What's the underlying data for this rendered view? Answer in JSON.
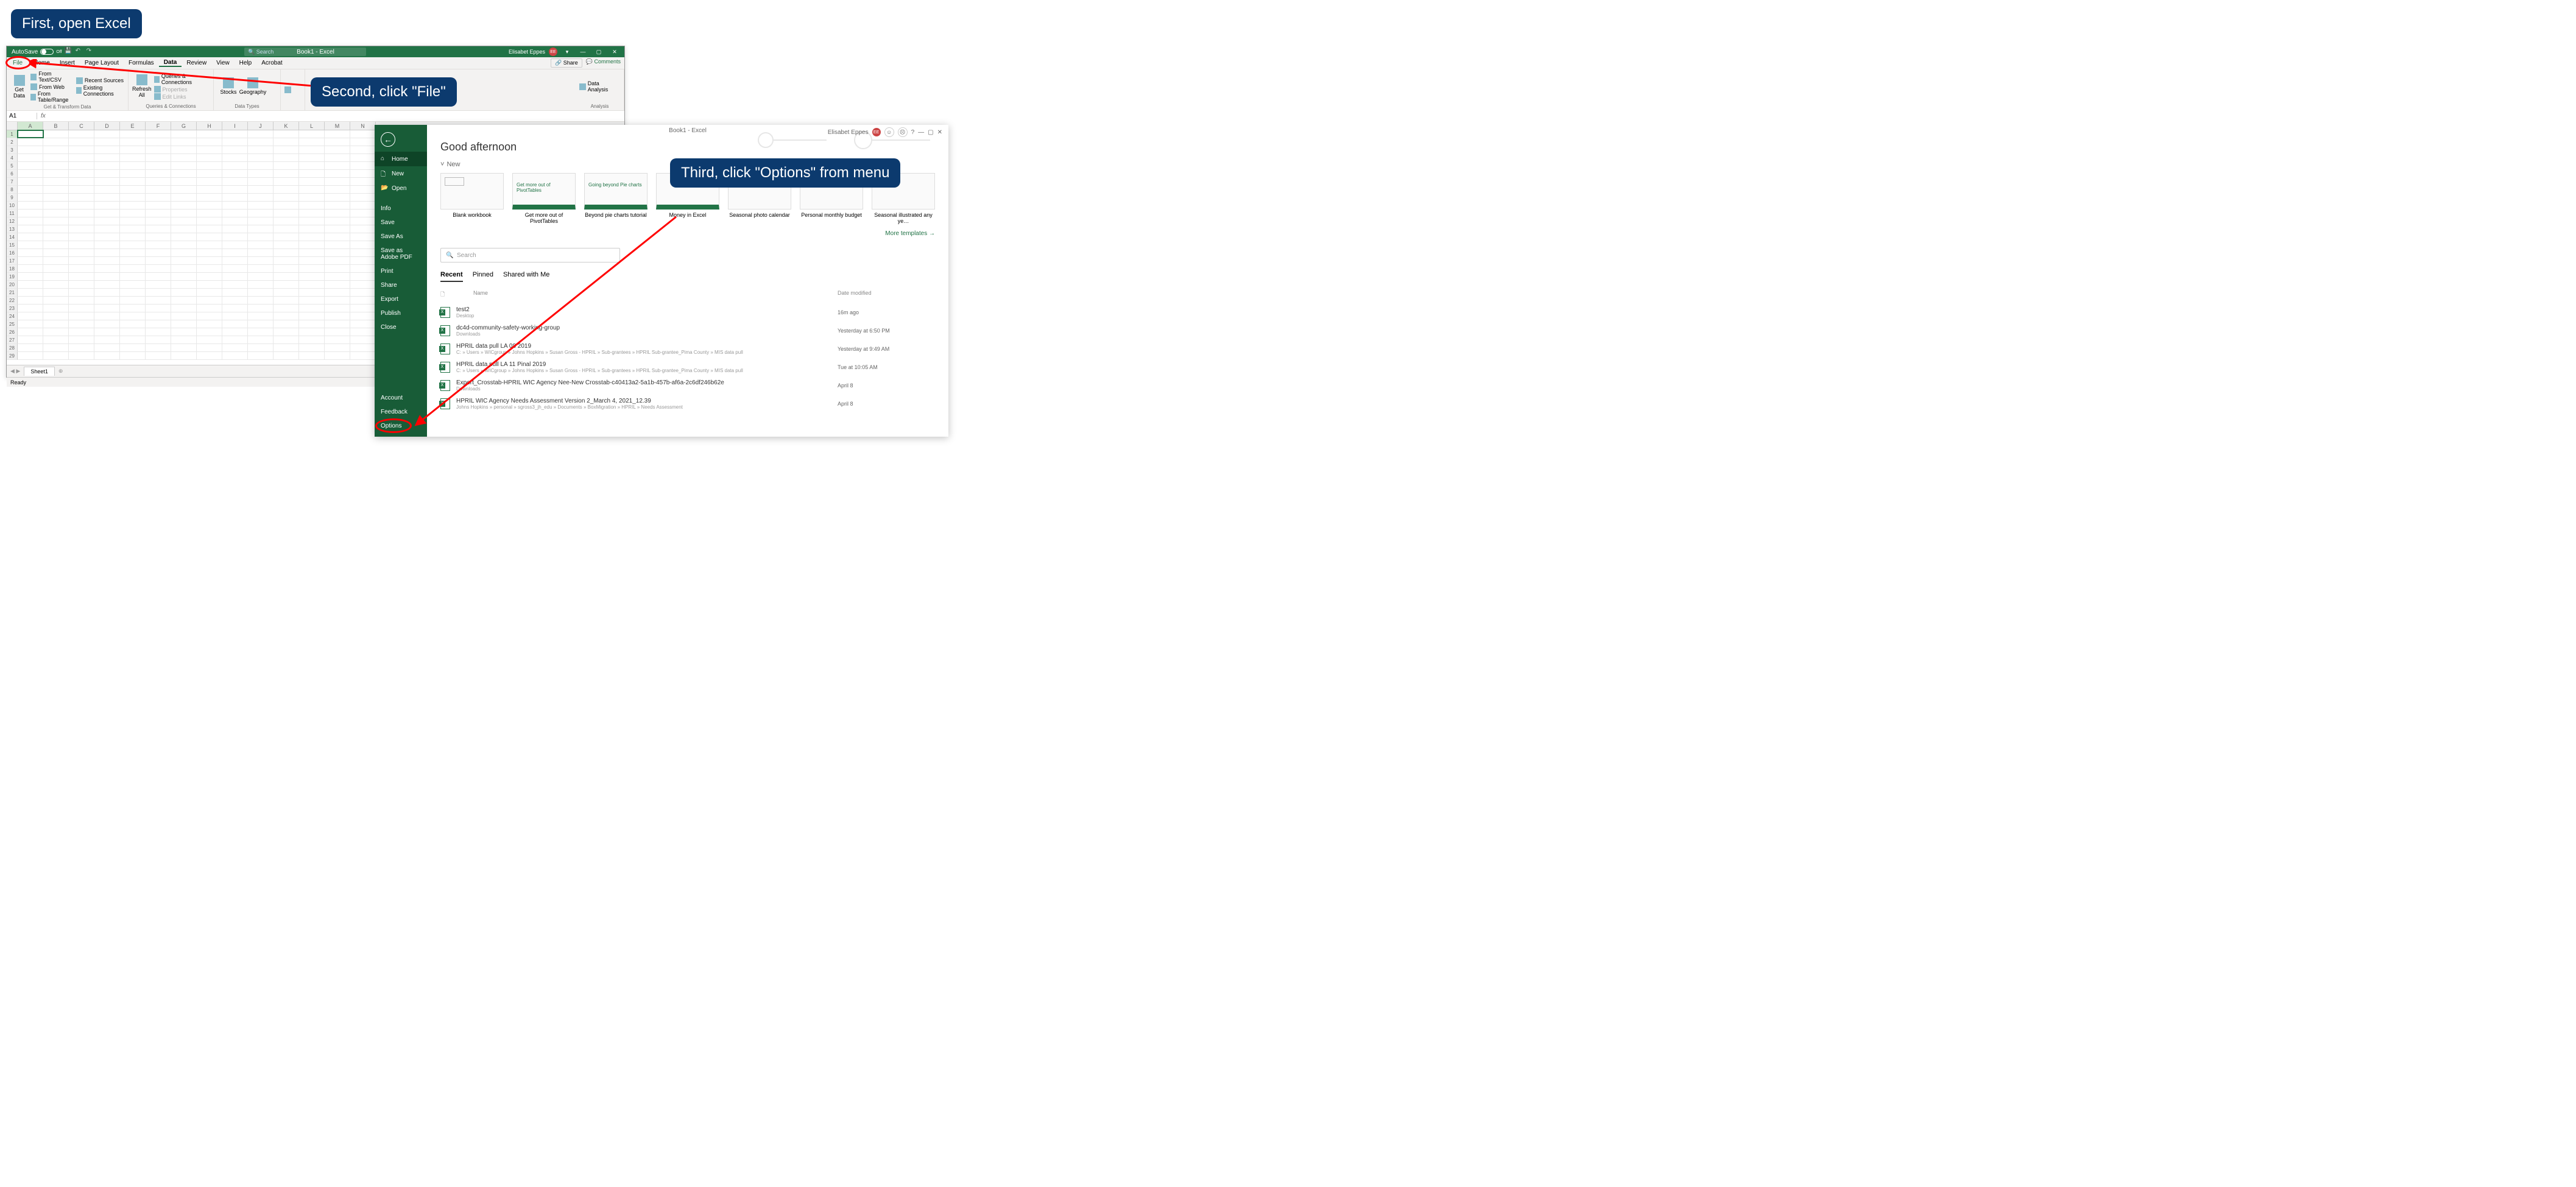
{
  "annotations": {
    "first": "First, open Excel",
    "second": "Second, click \"File\"",
    "third": "Third, click \"Options\" from menu"
  },
  "excel": {
    "autosave_label": "AutoSave",
    "autosave_state": "Off",
    "doc_title": "Book1  -  Excel",
    "search_placeholder": "Search",
    "user_name": "Elisabet Eppes",
    "user_initials": "EE",
    "tabs": [
      "File",
      "Home",
      "Insert",
      "Page Layout",
      "Formulas",
      "Data",
      "Review",
      "View",
      "Help",
      "Acrobat"
    ],
    "active_tab": "Data",
    "share_label": "Share",
    "comments_label": "Comments",
    "ribbon": {
      "get_data": "Get Data",
      "from_text_csv": "From Text/CSV",
      "from_web": "From Web",
      "from_table_range": "From Table/Range",
      "recent_sources": "Recent Sources",
      "existing_connections": "Existing Connections",
      "group1_label": "Get & Transform Data",
      "refresh_all": "Refresh All",
      "queries_connections": "Queries & Connections",
      "properties": "Properties",
      "edit_links": "Edit Links",
      "group2_label": "Queries & Connections",
      "stocks": "Stocks",
      "geography": "Geography",
      "group3_label": "Data Types",
      "data_analysis": "Data Analysis",
      "group_analysis": "Analysis"
    },
    "name_box": "A1",
    "fx_label": "fx",
    "columns": [
      "A",
      "B",
      "C",
      "D",
      "E",
      "F",
      "G",
      "H",
      "I",
      "J",
      "K",
      "L",
      "M",
      "N"
    ],
    "row_count": 29,
    "sheet_name": "Sheet1",
    "status": "Ready"
  },
  "backstage": {
    "doc_title": "Book1  -  Excel",
    "user_name": "Elisabet Eppes",
    "user_initials": "EE",
    "greeting": "Good afternoon",
    "nav": {
      "home": "Home",
      "new": "New",
      "open": "Open",
      "info": "Info",
      "save": "Save",
      "save_as": "Save As",
      "save_adobe": "Save as Adobe PDF",
      "print": "Print",
      "share": "Share",
      "export": "Export",
      "publish": "Publish",
      "close": "Close",
      "account": "Account",
      "feedback": "Feedback",
      "options": "Options"
    },
    "new_section": "New",
    "templates": [
      {
        "label": "Blank workbook"
      },
      {
        "label": "Get more out of PivotTables",
        "caption": "Get more out of PivotTables"
      },
      {
        "label": "Beyond pie charts tutorial",
        "caption": "Going beyond Pie charts"
      },
      {
        "label": "Money in Excel"
      },
      {
        "label": "Seasonal photo calendar"
      },
      {
        "label": "Personal monthly budget"
      },
      {
        "label": "Seasonal illustrated any ye…"
      }
    ],
    "more_templates": "More templates",
    "search_placeholder": "Search",
    "doc_tabs": {
      "recent": "Recent",
      "pinned": "Pinned",
      "shared": "Shared with Me"
    },
    "list_headers": {
      "name": "Name",
      "date": "Date modified"
    },
    "documents": [
      {
        "name": "test2",
        "path": "Desktop",
        "date": "16m ago"
      },
      {
        "name": "dc4d-community-safety-working-group",
        "path": "Downloads",
        "date": "Yesterday at 6:50 PM"
      },
      {
        "name": "HPRIL data pull LA 08 2019",
        "path": "C: » Users » WICgroup » Johns Hopkins » Susan Gross - HPRIL » Sub-grantees » HPRIL Sub-grantee_Pima County » MIS data pull",
        "date": "Yesterday at 9:49 AM"
      },
      {
        "name": "HPRIL data pull LA 11 Pinal 2019",
        "path": "C: » Users » WICgroup » Johns Hopkins » Susan Gross - HPRIL » Sub-grantees » HPRIL Sub-grantee_Pima County » MIS data pull",
        "date": "Tue at 10:05 AM"
      },
      {
        "name": "Export_Crosstab-HPRIL WIC Agency Nee-New Crosstab-c40413a2-5a1b-457b-af6a-2c6df246b62e",
        "path": "Downloads",
        "date": "April 8"
      },
      {
        "name": "HPRIL WIC Agency Needs Assessment Version 2_March 4, 2021_12.39",
        "path": "Johns Hopkins » personal » sgross3_jh_edu » Documents » BoxMigration » HPRIL » Needs Assessment",
        "date": "April 8"
      }
    ]
  }
}
